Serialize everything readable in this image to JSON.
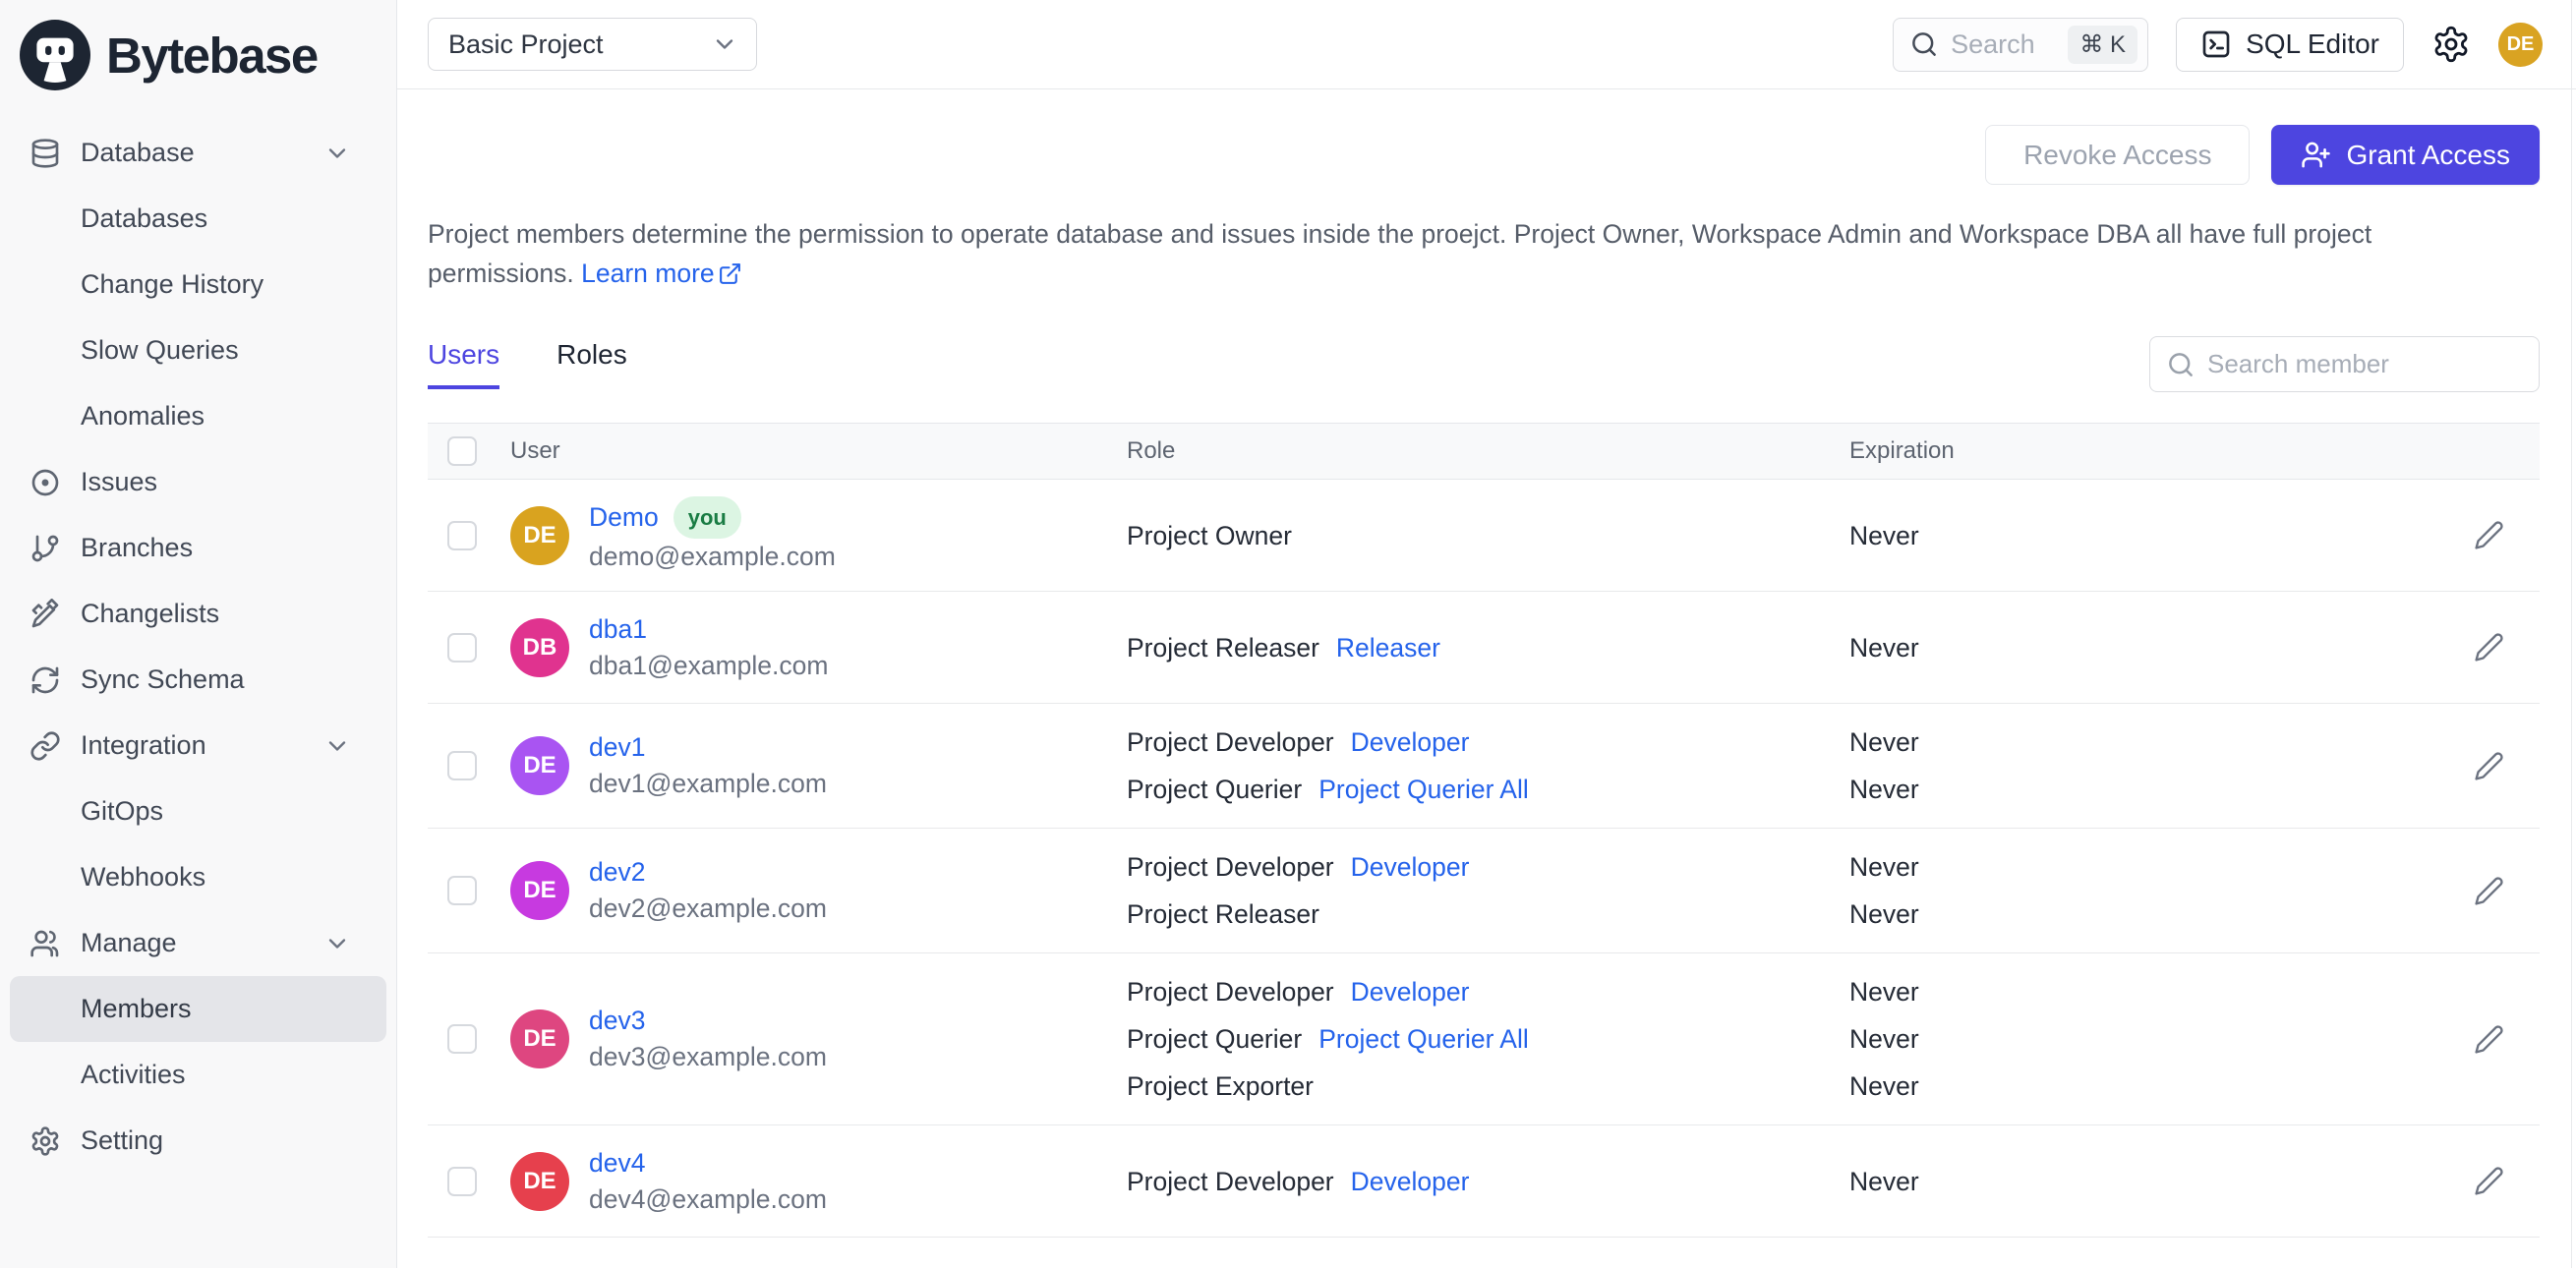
{
  "brand": {
    "name": "Bytebase",
    "logo_icon": "bytebase-robot-icon",
    "logo_color": "#1d2532"
  },
  "topbar": {
    "project_selector": {
      "value": "Basic Project",
      "chevron_icon": "chevron-down-icon"
    },
    "search": {
      "icon": "search-icon",
      "placeholder": "Search",
      "shortcut": "⌘ K"
    },
    "sql_editor": {
      "icon": "terminal-icon",
      "label": "SQL Editor"
    },
    "settings_icon": "gear-icon",
    "avatar": {
      "initials": "DE",
      "color": "#d9a322"
    }
  },
  "sidebar": {
    "items": [
      {
        "label": "Database",
        "icon": "database-icon",
        "chevron": true
      },
      {
        "label": "Databases",
        "indent": true
      },
      {
        "label": "Change History",
        "indent": true
      },
      {
        "label": "Slow Queries",
        "indent": true
      },
      {
        "label": "Anomalies",
        "indent": true
      },
      {
        "label": "Issues",
        "icon": "issues-icon"
      },
      {
        "label": "Branches",
        "icon": "branch-icon"
      },
      {
        "label": "Changelists",
        "icon": "changelist-icon"
      },
      {
        "label": "Sync Schema",
        "icon": "sync-icon"
      },
      {
        "label": "Integration",
        "icon": "link-icon",
        "chevron": true
      },
      {
        "label": "GitOps",
        "indent": true
      },
      {
        "label": "Webhooks",
        "indent": true
      },
      {
        "label": "Manage",
        "icon": "users-icon",
        "chevron": true
      },
      {
        "label": "Members",
        "indent": true,
        "active": true
      },
      {
        "label": "Activities",
        "indent": true
      },
      {
        "label": "Setting",
        "icon": "gear-icon"
      }
    ]
  },
  "main": {
    "actions": {
      "revoke_label": "Revoke Access",
      "grant_label": "Grant Access",
      "grant_icon": "user-plus-icon",
      "grant_color": "#4d45e0"
    },
    "description": {
      "text": "Project members determine the permission to operate database and issues inside the proejct. Project Owner, Workspace Admin and Workspace DBA all have full project permissions.",
      "link_label": "Learn more",
      "link_icon": "external-link-icon",
      "link_color": "#2563eb"
    },
    "tabs": [
      {
        "label": "Users",
        "active": true
      },
      {
        "label": "Roles",
        "active": false
      }
    ],
    "member_search": {
      "icon": "search-icon",
      "placeholder": "Search member"
    },
    "table": {
      "columns": [
        "User",
        "Role",
        "Expiration"
      ],
      "edit_icon": "pencil-icon",
      "rows": [
        {
          "initials": "DE",
          "avatar_color": "#d9a31f",
          "name": "Demo",
          "badge": "you",
          "email": "demo@example.com",
          "roles": [
            {
              "title": "Project Owner",
              "link": ""
            }
          ],
          "expirations": [
            "Never"
          ]
        },
        {
          "initials": "DB",
          "avatar_color": "#e0338f",
          "name": "dba1",
          "email": "dba1@example.com",
          "roles": [
            {
              "title": "Project Releaser",
              "link": "Releaser"
            }
          ],
          "expirations": [
            "Never"
          ]
        },
        {
          "initials": "DE",
          "avatar_color": "#a954f2",
          "name": "dev1",
          "email": "dev1@example.com",
          "roles": [
            {
              "title": "Project Developer",
              "link": "Developer"
            },
            {
              "title": "Project Querier",
              "link": "Project Querier All"
            }
          ],
          "expirations": [
            "Never",
            "Never"
          ]
        },
        {
          "initials": "DE",
          "avatar_color": "#c73ae0",
          "name": "dev2",
          "email": "dev2@example.com",
          "roles": [
            {
              "title": "Project Developer",
              "link": "Developer"
            },
            {
              "title": "Project Releaser",
              "link": ""
            }
          ],
          "expirations": [
            "Never",
            "Never"
          ]
        },
        {
          "initials": "DE",
          "avatar_color": "#de4680",
          "name": "dev3",
          "email": "dev3@example.com",
          "roles": [
            {
              "title": "Project Developer",
              "link": "Developer"
            },
            {
              "title": "Project Querier",
              "link": "Project Querier All"
            },
            {
              "title": "Project Exporter",
              "link": ""
            }
          ],
          "expirations": [
            "Never",
            "Never",
            "Never"
          ]
        },
        {
          "initials": "DE",
          "avatar_color": "#e6404d",
          "name": "dev4",
          "email": "dev4@example.com",
          "roles": [
            {
              "title": "Project Developer",
              "link": "Developer"
            }
          ],
          "expirations": [
            "Never"
          ]
        }
      ]
    }
  }
}
